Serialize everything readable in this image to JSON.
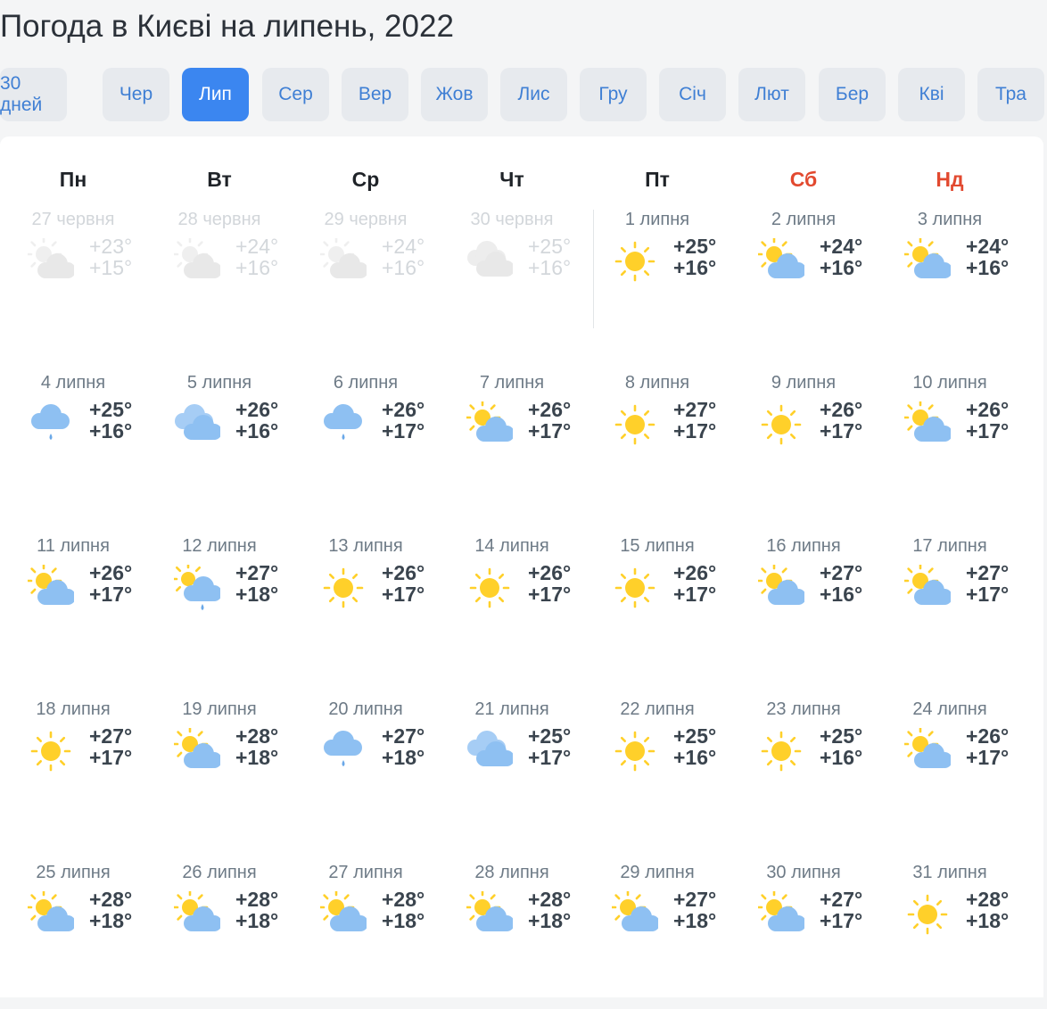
{
  "page": {
    "title": "Погода в Києві на липень, 2022"
  },
  "months": [
    {
      "label": "30 дней",
      "active": false
    },
    {
      "label": "Чер",
      "active": false
    },
    {
      "label": "Лип",
      "active": true
    },
    {
      "label": "Сер",
      "active": false
    },
    {
      "label": "Вер",
      "active": false
    },
    {
      "label": "Жов",
      "active": false
    },
    {
      "label": "Лис",
      "active": false
    },
    {
      "label": "Гру",
      "active": false
    },
    {
      "label": "Січ",
      "active": false
    },
    {
      "label": "Лют",
      "active": false
    },
    {
      "label": "Бер",
      "active": false
    },
    {
      "label": "Кві",
      "active": false
    },
    {
      "label": "Тра",
      "active": false
    }
  ],
  "weekdays": [
    {
      "label": "Пн",
      "weekend": false
    },
    {
      "label": "Вт",
      "weekend": false
    },
    {
      "label": "Ср",
      "weekend": false
    },
    {
      "label": "Чт",
      "weekend": false
    },
    {
      "label": "Пт",
      "weekend": false
    },
    {
      "label": "Сб",
      "weekend": true
    },
    {
      "label": "Нд",
      "weekend": true
    }
  ],
  "colors": {
    "accent": "#3b86f0",
    "weekend": "#e2492f",
    "sun": "#ffd02a",
    "cloud": "#8ec0f2"
  },
  "weeks": [
    [
      {
        "date": "27 червня",
        "high": "+23°",
        "low": "+15°",
        "icon": "sun-cloud",
        "past": true
      },
      {
        "date": "28 червня",
        "high": "+24°",
        "low": "+16°",
        "icon": "sun-cloud",
        "past": true
      },
      {
        "date": "29 червня",
        "high": "+24°",
        "low": "+16°",
        "icon": "sun-cloud",
        "past": true
      },
      {
        "date": "30 червня",
        "high": "+25°",
        "low": "+16°",
        "icon": "cloudy",
        "past": true
      },
      {
        "date": "1 липня",
        "high": "+25°",
        "low": "+16°",
        "icon": "sun",
        "past": false
      },
      {
        "date": "2 липня",
        "high": "+24°",
        "low": "+16°",
        "icon": "sun-cloud",
        "past": false
      },
      {
        "date": "3 липня",
        "high": "+24°",
        "low": "+16°",
        "icon": "sun-cloud",
        "past": false
      }
    ],
    [
      {
        "date": "4 липня",
        "high": "+25°",
        "low": "+16°",
        "icon": "rain",
        "past": false
      },
      {
        "date": "5 липня",
        "high": "+26°",
        "low": "+16°",
        "icon": "cloudy",
        "past": false
      },
      {
        "date": "6 липня",
        "high": "+26°",
        "low": "+17°",
        "icon": "rain",
        "past": false
      },
      {
        "date": "7 липня",
        "high": "+26°",
        "low": "+17°",
        "icon": "sun-cloud",
        "past": false
      },
      {
        "date": "8 липня",
        "high": "+27°",
        "low": "+17°",
        "icon": "sun",
        "past": false
      },
      {
        "date": "9 липня",
        "high": "+26°",
        "low": "+17°",
        "icon": "sun",
        "past": false
      },
      {
        "date": "10 липня",
        "high": "+26°",
        "low": "+17°",
        "icon": "sun-cloud",
        "past": false
      }
    ],
    [
      {
        "date": "11 липня",
        "high": "+26°",
        "low": "+17°",
        "icon": "sun-cloud",
        "past": false
      },
      {
        "date": "12 липня",
        "high": "+27°",
        "low": "+18°",
        "icon": "sun-cloud-rain",
        "past": false
      },
      {
        "date": "13 липня",
        "high": "+26°",
        "low": "+17°",
        "icon": "sun",
        "past": false
      },
      {
        "date": "14 липня",
        "high": "+26°",
        "low": "+17°",
        "icon": "sun",
        "past": false
      },
      {
        "date": "15 липня",
        "high": "+26°",
        "low": "+17°",
        "icon": "sun",
        "past": false
      },
      {
        "date": "16 липня",
        "high": "+27°",
        "low": "+16°",
        "icon": "sun-cloud",
        "past": false
      },
      {
        "date": "17 липня",
        "high": "+27°",
        "low": "+17°",
        "icon": "sun-cloud",
        "past": false
      }
    ],
    [
      {
        "date": "18 липня",
        "high": "+27°",
        "low": "+17°",
        "icon": "sun",
        "past": false
      },
      {
        "date": "19 липня",
        "high": "+28°",
        "low": "+18°",
        "icon": "sun-cloud",
        "past": false
      },
      {
        "date": "20 липня",
        "high": "+27°",
        "low": "+18°",
        "icon": "rain",
        "past": false
      },
      {
        "date": "21 липня",
        "high": "+25°",
        "low": "+17°",
        "icon": "cloudy",
        "past": false
      },
      {
        "date": "22 липня",
        "high": "+25°",
        "low": "+16°",
        "icon": "sun",
        "past": false
      },
      {
        "date": "23 липня",
        "high": "+25°",
        "low": "+16°",
        "icon": "sun",
        "past": false
      },
      {
        "date": "24 липня",
        "high": "+26°",
        "low": "+17°",
        "icon": "sun-cloud",
        "past": false
      }
    ],
    [
      {
        "date": "25 липня",
        "high": "+28°",
        "low": "+18°",
        "icon": "sun-cloud",
        "past": false
      },
      {
        "date": "26 липня",
        "high": "+28°",
        "low": "+18°",
        "icon": "sun-cloud",
        "past": false
      },
      {
        "date": "27 липня",
        "high": "+28°",
        "low": "+18°",
        "icon": "sun-cloud",
        "past": false
      },
      {
        "date": "28 липня",
        "high": "+28°",
        "low": "+18°",
        "icon": "sun-cloud",
        "past": false
      },
      {
        "date": "29 липня",
        "high": "+27°",
        "low": "+18°",
        "icon": "sun-cloud",
        "past": false
      },
      {
        "date": "30 липня",
        "high": "+27°",
        "low": "+17°",
        "icon": "sun-cloud",
        "past": false
      },
      {
        "date": "31 липня",
        "high": "+28°",
        "low": "+18°",
        "icon": "sun",
        "past": false
      }
    ]
  ]
}
